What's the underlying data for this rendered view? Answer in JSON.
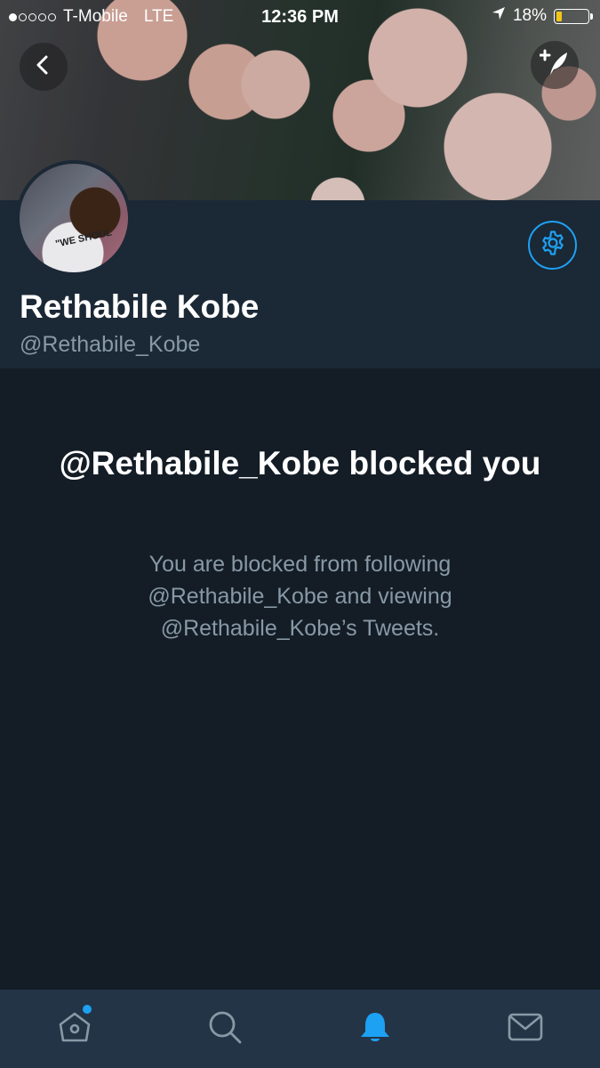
{
  "status_bar": {
    "carrier": "T-Mobile",
    "network": "LTE",
    "time": "12:36 PM",
    "battery_percent": "18%",
    "battery_level": 0.18,
    "signal_bars_filled": 1,
    "signal_bars_total": 5
  },
  "profile": {
    "display_name": "Rethabile Kobe",
    "handle": "@Rethabile_Kobe",
    "avatar_shirt_text": "\"WE SHOUL"
  },
  "blocked": {
    "title": "@Rethabile_Kobe blocked you",
    "message": "You are blocked from following @Rethabile_Kobe and viewing @Rethabile_Kobe’s Tweets."
  },
  "tabs": [
    {
      "icon": "home-icon",
      "has_notification_dot": true,
      "active": false
    },
    {
      "icon": "search-icon",
      "has_notification_dot": false,
      "active": false
    },
    {
      "icon": "bell-icon",
      "has_notification_dot": false,
      "active": true
    },
    {
      "icon": "mail-icon",
      "has_notification_dot": false,
      "active": false
    }
  ],
  "colors": {
    "background": "#141d26",
    "header_panel": "#1b2836",
    "tab_bar": "#243447",
    "accent": "#1da1f2",
    "secondary_text": "#8899a6",
    "inactive_icon": "#8899a6",
    "battery_fill": "#f5c518"
  }
}
